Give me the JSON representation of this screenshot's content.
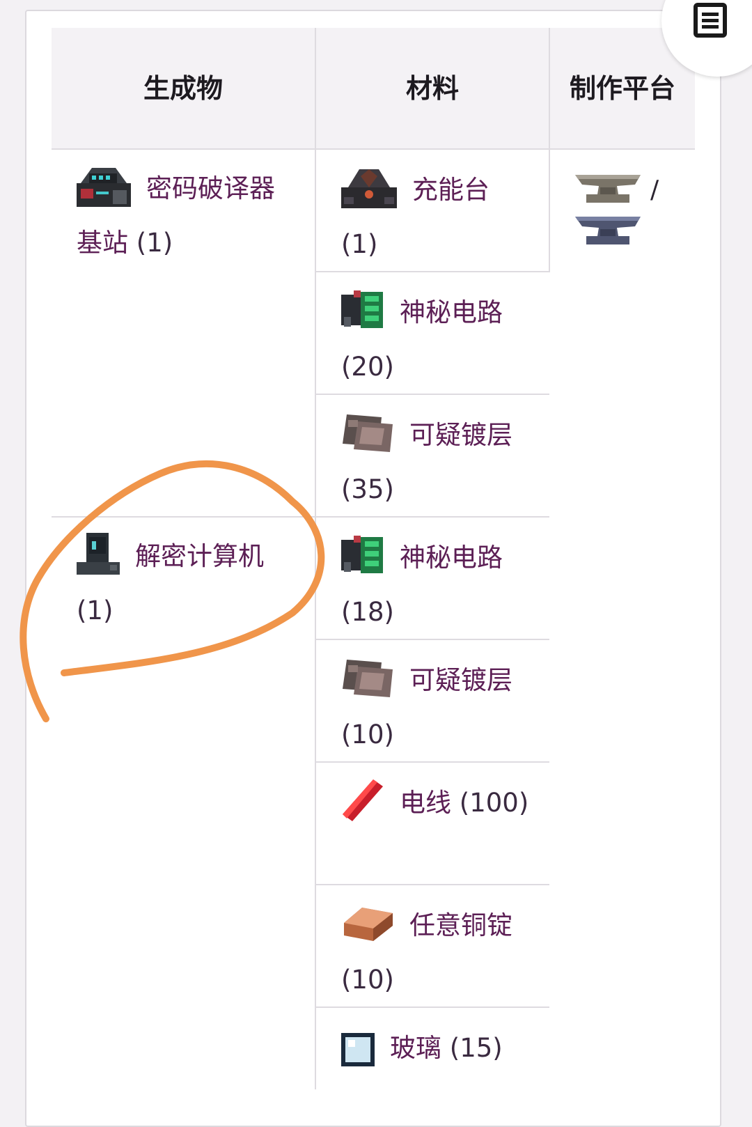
{
  "table": {
    "headers": {
      "result": "生成物",
      "materials": "材料",
      "station": "制作平台"
    },
    "station": {
      "separator": "/",
      "icons": [
        "iron-anvil-icon",
        "lead-anvil-icon"
      ]
    },
    "recipes": [
      {
        "result": {
          "icon": "codebreaker-base-icon",
          "name": "密码破译器基站",
          "count": "(1)"
        },
        "materials": [
          {
            "icon": "charging-station-icon",
            "name": "充能台",
            "count": "(1)"
          },
          {
            "icon": "mysterious-circuitry-icon",
            "name": "神秘电路",
            "count": "(20)"
          },
          {
            "icon": "dubious-plating-icon",
            "name": "可疑镀层",
            "count": "(35)"
          }
        ]
      },
      {
        "result": {
          "icon": "decryption-computer-icon",
          "name": "解密计算机",
          "count": "(1)"
        },
        "materials": [
          {
            "icon": "mysterious-circuitry-icon",
            "name": "神秘电路",
            "count": "(18)"
          },
          {
            "icon": "dubious-plating-icon",
            "name": "可疑镀层",
            "count": "(10)"
          },
          {
            "icon": "wire-icon",
            "name": "电线",
            "count": "(100)"
          },
          {
            "icon": "copper-bar-icon",
            "name": "任意铜锭",
            "count": "(10)"
          },
          {
            "icon": "glass-icon",
            "name": "玻璃",
            "count": "(15)"
          }
        ]
      }
    ]
  },
  "annotation": {
    "color": "#f0954a"
  },
  "colors": {
    "link": "#5c1f55",
    "header_bg": "#f4f2f5",
    "border": "#dedbe0"
  }
}
